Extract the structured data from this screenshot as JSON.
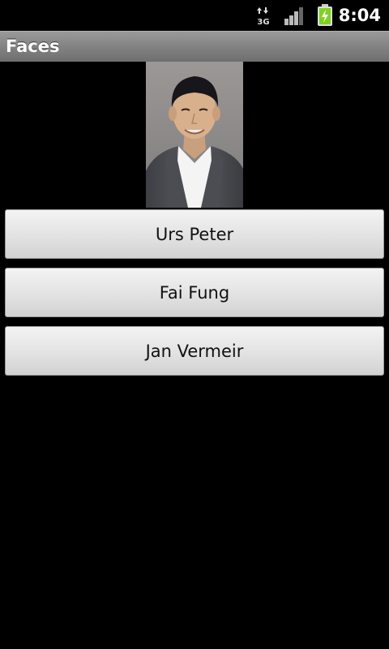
{
  "status_bar": {
    "time": "8:04",
    "network_label": "3G",
    "icons": [
      "network-3g-icon",
      "signal-strength-icon",
      "battery-charging-icon"
    ]
  },
  "app": {
    "title": "Faces"
  },
  "photo": {
    "icon": "person-photo"
  },
  "answers": [
    {
      "label": "Urs Peter"
    },
    {
      "label": "Fai Fung"
    },
    {
      "label": "Jan Vermeir"
    }
  ],
  "colors": {
    "background": "#000000",
    "title_bar": "#808080",
    "button": "#e4e4e4",
    "battery": "#7ed321"
  }
}
